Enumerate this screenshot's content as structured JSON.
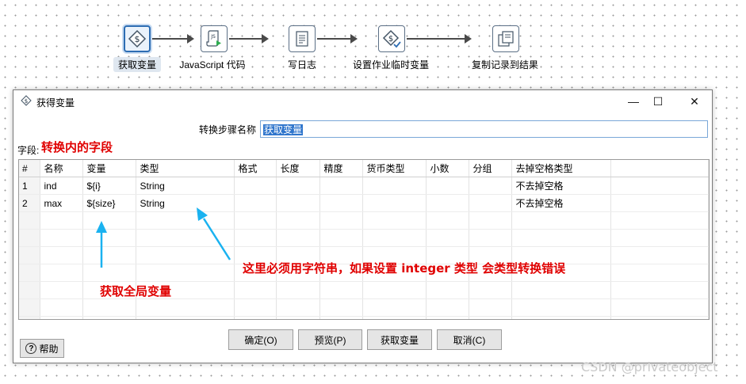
{
  "pipeline": {
    "steps": [
      {
        "label": "获取变量",
        "icon": "get-variables-icon",
        "selected": true
      },
      {
        "label": "JavaScript 代码",
        "icon": "javascript-icon",
        "selected": false
      },
      {
        "label": "写日志",
        "icon": "write-log-icon",
        "selected": false
      },
      {
        "label": "设置作业临时变量",
        "icon": "set-variables-icon",
        "selected": false
      },
      {
        "label": "复制记录到结果",
        "icon": "copy-rows-icon",
        "selected": false
      }
    ]
  },
  "dialog": {
    "title": "获得变量",
    "minimize": "—",
    "maximize": "☐",
    "close": "✕",
    "step_name_label": "转换步骤名称",
    "step_name_value": "获取变量",
    "fields_label": "字段:",
    "columns": [
      "#",
      "名称",
      "变量",
      "类型",
      "格式",
      "长度",
      "精度",
      "货币类型",
      "小数",
      "分组",
      "去掉空格类型"
    ],
    "rows": [
      [
        "1",
        "ind",
        "${i}",
        "String",
        "",
        "",
        "",
        "",
        "",
        "",
        "不去掉空格"
      ],
      [
        "2",
        "max",
        "${size}",
        "String",
        "",
        "",
        "",
        "",
        "",
        "",
        "不去掉空格"
      ]
    ],
    "buttons": {
      "ok": "确定(O)",
      "preview": "预览(P)",
      "get_variables": "获取变量",
      "cancel": "取消(C)",
      "help": "帮助"
    }
  },
  "annotations": {
    "fields": "转换内的字段",
    "global_var": "获取全局变量",
    "type_note": "这里必须用字符串，如果设置 integer 类型 会类型转换错误"
  },
  "watermark": "CSDN @privateobject",
  "colors": {
    "annotation": "#e00000",
    "arrow": "#1ab2f0",
    "selection": "#3076cc"
  }
}
